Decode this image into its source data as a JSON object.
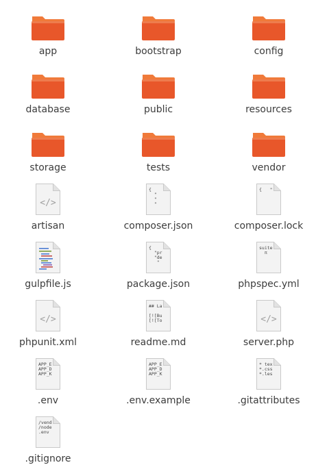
{
  "colors": {
    "folder_body": "#e8572a",
    "folder_tab": "#f07a3a",
    "file_bg": "#f3f3f3",
    "file_border": "#c9c9c9",
    "code_glyph": "#a0a0a0"
  },
  "files": [
    {
      "name": "app",
      "type": "folder",
      "icon": "folder-icon"
    },
    {
      "name": "bootstrap",
      "type": "folder",
      "icon": "folder-icon"
    },
    {
      "name": "config",
      "type": "folder",
      "icon": "folder-icon"
    },
    {
      "name": "database",
      "type": "folder",
      "icon": "folder-icon"
    },
    {
      "name": "public",
      "type": "folder",
      "icon": "folder-icon"
    },
    {
      "name": "resources",
      "type": "folder",
      "icon": "folder-icon"
    },
    {
      "name": "storage",
      "type": "folder",
      "icon": "folder-icon"
    },
    {
      "name": "tests",
      "type": "folder",
      "icon": "folder-icon"
    },
    {
      "name": "vendor",
      "type": "folder",
      "icon": "folder-icon"
    },
    {
      "name": "artisan",
      "type": "code",
      "icon": "code-file-icon"
    },
    {
      "name": "composer.json",
      "type": "text",
      "icon": "text-file-icon",
      "preview": [
        "{",
        "  \"",
        "  \"",
        "  \""
      ]
    },
    {
      "name": "composer.lock",
      "type": "text",
      "icon": "text-file-icon",
      "preview": [
        "{   \""
      ]
    },
    {
      "name": "gulpfile.js",
      "type": "script",
      "icon": "script-file-icon"
    },
    {
      "name": "package.json",
      "type": "text",
      "icon": "text-file-icon",
      "preview": [
        "{",
        "  \"pr",
        "  \"de",
        "   \""
      ]
    },
    {
      "name": "phpspec.yml",
      "type": "text",
      "icon": "text-file-icon",
      "preview": [
        "suite",
        "  π"
      ]
    },
    {
      "name": "phpunit.xml",
      "type": "code",
      "icon": "code-file-icon"
    },
    {
      "name": "readme.md",
      "type": "text",
      "icon": "text-file-icon",
      "preview": [
        "## La",
        "",
        "[![Bu",
        "[![To"
      ]
    },
    {
      "name": "server.php",
      "type": "code",
      "icon": "code-file-icon"
    },
    {
      "name": ".env",
      "type": "text",
      "icon": "text-file-icon",
      "preview": [
        "APP_E",
        "APP_D",
        "APP_K"
      ]
    },
    {
      "name": ".env.example",
      "type": "text",
      "icon": "text-file-icon",
      "preview": [
        "APP_E",
        "APP_D",
        "APP_K"
      ]
    },
    {
      "name": ".gitattributes",
      "type": "text",
      "icon": "text-file-icon",
      "preview": [
        "* tex",
        "*.css",
        "*.les"
      ]
    },
    {
      "name": ".gitignore",
      "type": "text",
      "icon": "text-file-icon",
      "preview": [
        "/vend",
        "/node",
        ".env"
      ]
    }
  ]
}
